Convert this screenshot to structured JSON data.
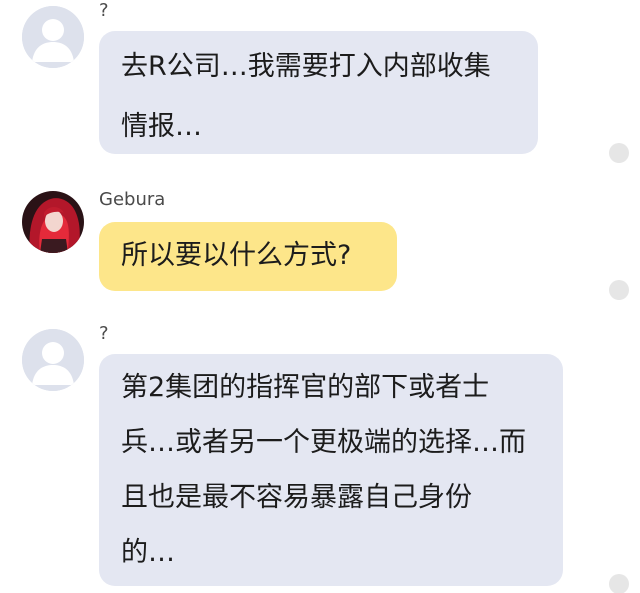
{
  "messages": [
    {
      "sender": "?",
      "text": "去R公司…我需要打入内部收集\n情报…",
      "avatar": "default-user-icon",
      "bubble_color": "#e4e7f2"
    },
    {
      "sender": "Gebura",
      "text": "所以要以什么方式?",
      "avatar": "gebura-avatar",
      "bubble_color": "#fde68a"
    },
    {
      "sender": "?",
      "text": "第2集团的指挥官的部下或者士\n兵…或者另一个更极端的选择…而\n且也是最不容易暴露自己身份\n的…",
      "avatar": "default-user-icon",
      "bubble_color": "#e4e7f2"
    }
  ],
  "colors": {
    "gray_bubble": "#e4e7f2",
    "yellow_bubble": "#fde68a",
    "status_dot": "#e6e6e6"
  }
}
